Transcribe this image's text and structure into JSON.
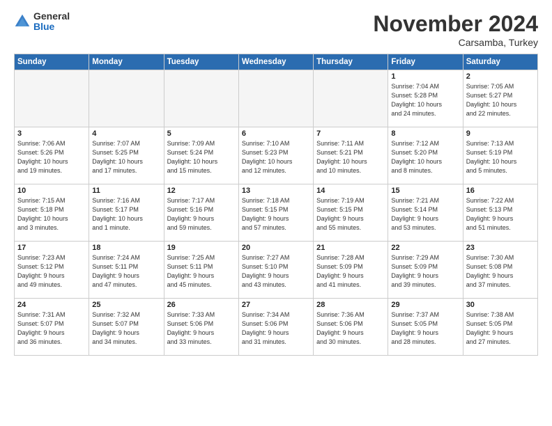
{
  "logo": {
    "general": "General",
    "blue": "Blue"
  },
  "header": {
    "month": "November 2024",
    "location": "Carsamba, Turkey"
  },
  "weekdays": [
    "Sunday",
    "Monday",
    "Tuesday",
    "Wednesday",
    "Thursday",
    "Friday",
    "Saturday"
  ],
  "weeks": [
    [
      {
        "day": "",
        "info": ""
      },
      {
        "day": "",
        "info": ""
      },
      {
        "day": "",
        "info": ""
      },
      {
        "day": "",
        "info": ""
      },
      {
        "day": "",
        "info": ""
      },
      {
        "day": "1",
        "info": "Sunrise: 7:04 AM\nSunset: 5:28 PM\nDaylight: 10 hours\nand 24 minutes."
      },
      {
        "day": "2",
        "info": "Sunrise: 7:05 AM\nSunset: 5:27 PM\nDaylight: 10 hours\nand 22 minutes."
      }
    ],
    [
      {
        "day": "3",
        "info": "Sunrise: 7:06 AM\nSunset: 5:26 PM\nDaylight: 10 hours\nand 19 minutes."
      },
      {
        "day": "4",
        "info": "Sunrise: 7:07 AM\nSunset: 5:25 PM\nDaylight: 10 hours\nand 17 minutes."
      },
      {
        "day": "5",
        "info": "Sunrise: 7:09 AM\nSunset: 5:24 PM\nDaylight: 10 hours\nand 15 minutes."
      },
      {
        "day": "6",
        "info": "Sunrise: 7:10 AM\nSunset: 5:23 PM\nDaylight: 10 hours\nand 12 minutes."
      },
      {
        "day": "7",
        "info": "Sunrise: 7:11 AM\nSunset: 5:21 PM\nDaylight: 10 hours\nand 10 minutes."
      },
      {
        "day": "8",
        "info": "Sunrise: 7:12 AM\nSunset: 5:20 PM\nDaylight: 10 hours\nand 8 minutes."
      },
      {
        "day": "9",
        "info": "Sunrise: 7:13 AM\nSunset: 5:19 PM\nDaylight: 10 hours\nand 5 minutes."
      }
    ],
    [
      {
        "day": "10",
        "info": "Sunrise: 7:15 AM\nSunset: 5:18 PM\nDaylight: 10 hours\nand 3 minutes."
      },
      {
        "day": "11",
        "info": "Sunrise: 7:16 AM\nSunset: 5:17 PM\nDaylight: 10 hours\nand 1 minute."
      },
      {
        "day": "12",
        "info": "Sunrise: 7:17 AM\nSunset: 5:16 PM\nDaylight: 9 hours\nand 59 minutes."
      },
      {
        "day": "13",
        "info": "Sunrise: 7:18 AM\nSunset: 5:15 PM\nDaylight: 9 hours\nand 57 minutes."
      },
      {
        "day": "14",
        "info": "Sunrise: 7:19 AM\nSunset: 5:15 PM\nDaylight: 9 hours\nand 55 minutes."
      },
      {
        "day": "15",
        "info": "Sunrise: 7:21 AM\nSunset: 5:14 PM\nDaylight: 9 hours\nand 53 minutes."
      },
      {
        "day": "16",
        "info": "Sunrise: 7:22 AM\nSunset: 5:13 PM\nDaylight: 9 hours\nand 51 minutes."
      }
    ],
    [
      {
        "day": "17",
        "info": "Sunrise: 7:23 AM\nSunset: 5:12 PM\nDaylight: 9 hours\nand 49 minutes."
      },
      {
        "day": "18",
        "info": "Sunrise: 7:24 AM\nSunset: 5:11 PM\nDaylight: 9 hours\nand 47 minutes."
      },
      {
        "day": "19",
        "info": "Sunrise: 7:25 AM\nSunset: 5:11 PM\nDaylight: 9 hours\nand 45 minutes."
      },
      {
        "day": "20",
        "info": "Sunrise: 7:27 AM\nSunset: 5:10 PM\nDaylight: 9 hours\nand 43 minutes."
      },
      {
        "day": "21",
        "info": "Sunrise: 7:28 AM\nSunset: 5:09 PM\nDaylight: 9 hours\nand 41 minutes."
      },
      {
        "day": "22",
        "info": "Sunrise: 7:29 AM\nSunset: 5:09 PM\nDaylight: 9 hours\nand 39 minutes."
      },
      {
        "day": "23",
        "info": "Sunrise: 7:30 AM\nSunset: 5:08 PM\nDaylight: 9 hours\nand 37 minutes."
      }
    ],
    [
      {
        "day": "24",
        "info": "Sunrise: 7:31 AM\nSunset: 5:07 PM\nDaylight: 9 hours\nand 36 minutes."
      },
      {
        "day": "25",
        "info": "Sunrise: 7:32 AM\nSunset: 5:07 PM\nDaylight: 9 hours\nand 34 minutes."
      },
      {
        "day": "26",
        "info": "Sunrise: 7:33 AM\nSunset: 5:06 PM\nDaylight: 9 hours\nand 33 minutes."
      },
      {
        "day": "27",
        "info": "Sunrise: 7:34 AM\nSunset: 5:06 PM\nDaylight: 9 hours\nand 31 minutes."
      },
      {
        "day": "28",
        "info": "Sunrise: 7:36 AM\nSunset: 5:06 PM\nDaylight: 9 hours\nand 30 minutes."
      },
      {
        "day": "29",
        "info": "Sunrise: 7:37 AM\nSunset: 5:05 PM\nDaylight: 9 hours\nand 28 minutes."
      },
      {
        "day": "30",
        "info": "Sunrise: 7:38 AM\nSunset: 5:05 PM\nDaylight: 9 hours\nand 27 minutes."
      }
    ]
  ]
}
